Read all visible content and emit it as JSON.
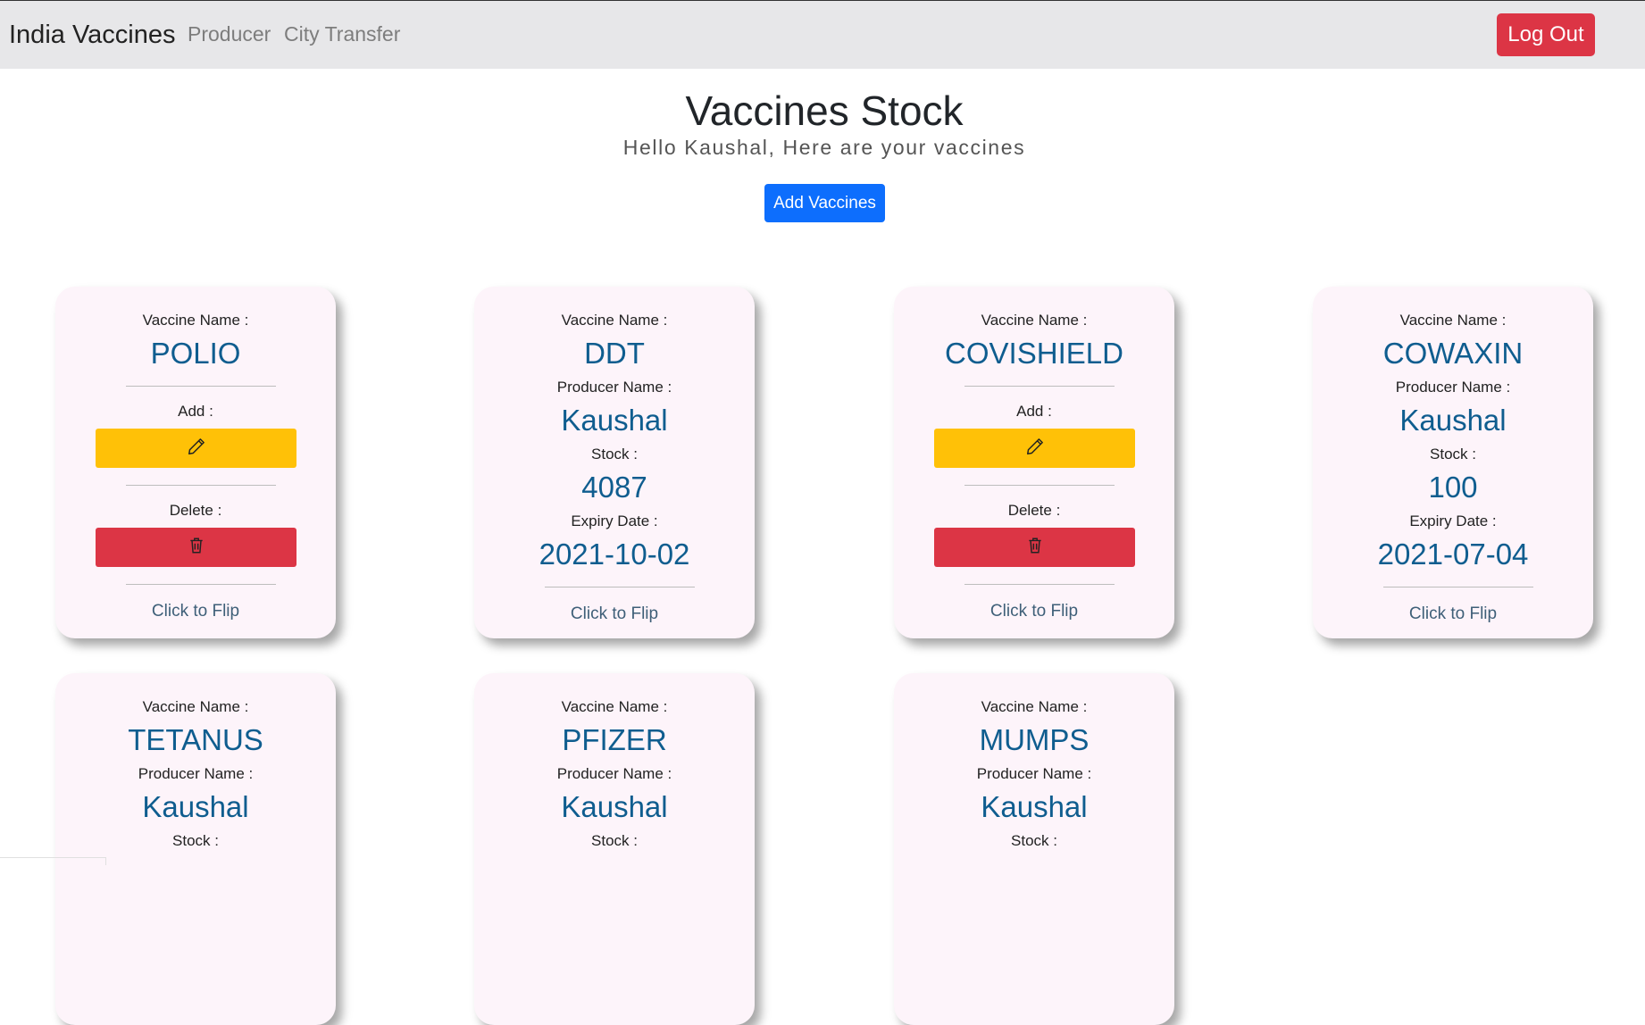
{
  "nav": {
    "brand": "India Vaccines",
    "links": [
      "Producer",
      "City Transfer"
    ],
    "logout_label": "Log Out"
  },
  "header": {
    "title": "Vaccines Stock",
    "subtitle": "Hello Kaushal, Here are your vaccines",
    "add_label": "Add Vaccines"
  },
  "labels": {
    "vaccine_name": "Vaccine Name :",
    "producer_name": "Producer Name :",
    "stock": "Stock :",
    "expiry": "Expiry Date :",
    "add": "Add :",
    "delete": "Delete :",
    "flip": "Click to Flip"
  },
  "cards": [
    {
      "name": "POLIO"
    },
    {
      "name": "DDT",
      "producer": "Kaushal",
      "stock": "4087",
      "expiry": "2021-10-02"
    },
    {
      "name": "COVISHIELD"
    },
    {
      "name": "COWAXIN",
      "producer": "Kaushal",
      "stock": "100",
      "expiry": "2021-07-04"
    },
    {
      "name": "TETANUS",
      "producer": "Kaushal"
    },
    {
      "name": "PFIZER",
      "producer": "Kaushal"
    },
    {
      "name": "MUMPS",
      "producer": "Kaushal"
    }
  ],
  "colors": {
    "navbar_bg": "#e7e7e9",
    "danger": "#dc3545",
    "primary": "#0d6efd",
    "warning": "#ffc107",
    "card_bg": "#fdf4fa",
    "value_text": "#0f5d8f"
  },
  "icons": {
    "edit": "pencil-icon",
    "delete": "trash-icon"
  }
}
